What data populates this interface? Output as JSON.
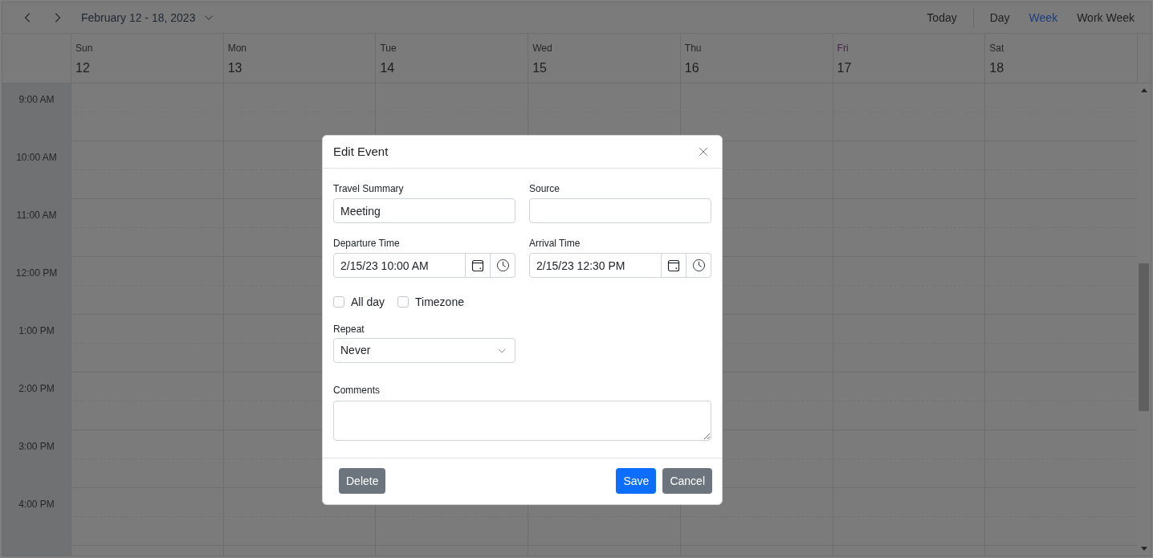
{
  "toolbar": {
    "date_range": "February 12 - 18, 2023",
    "today_button": "Today",
    "views": [
      {
        "label": "Day",
        "selected": false
      },
      {
        "label": "Week",
        "selected": true
      },
      {
        "label": "Work Week",
        "selected": false
      }
    ]
  },
  "days": [
    {
      "name": "Sun",
      "date": "12",
      "today": false
    },
    {
      "name": "Mon",
      "date": "13",
      "today": false
    },
    {
      "name": "Tue",
      "date": "14",
      "today": false
    },
    {
      "name": "Wed",
      "date": "15",
      "today": false
    },
    {
      "name": "Thu",
      "date": "16",
      "today": false
    },
    {
      "name": "Fri",
      "date": "17",
      "today": true
    },
    {
      "name": "Sat",
      "date": "18",
      "today": false
    }
  ],
  "time_slots": [
    "9:00 AM",
    "10:00 AM",
    "11:00 AM",
    "12:00 PM",
    "1:00 PM",
    "2:00 PM",
    "3:00 PM",
    "4:00 PM"
  ],
  "dialog": {
    "title": "Edit Event",
    "fields": [
      {
        "kind": "text",
        "label": "Travel Summary",
        "value": "Meeting"
      },
      {
        "kind": "text",
        "label": "Source"
      },
      {
        "kind": "datetime",
        "label": "Departure Time",
        "value": "2/15/23 10:00 AM"
      },
      {
        "kind": "datetime",
        "label": "Arrival Time",
        "value": "2/15/23 12:30 PM"
      }
    ],
    "options": [
      {
        "label": "All day",
        "checked": false
      },
      {
        "label": "Timezone",
        "checked": false
      }
    ],
    "repeat": {
      "label": "Repeat",
      "value": "Never"
    },
    "comments": {
      "label": "Comments"
    },
    "footer": {
      "left_buttons": [
        {
          "label": "Delete",
          "kind": "secondary"
        }
      ],
      "right_buttons": [
        {
          "label": "Save",
          "kind": "primary"
        },
        {
          "label": "Cancel",
          "kind": "secondary"
        }
      ]
    }
  }
}
